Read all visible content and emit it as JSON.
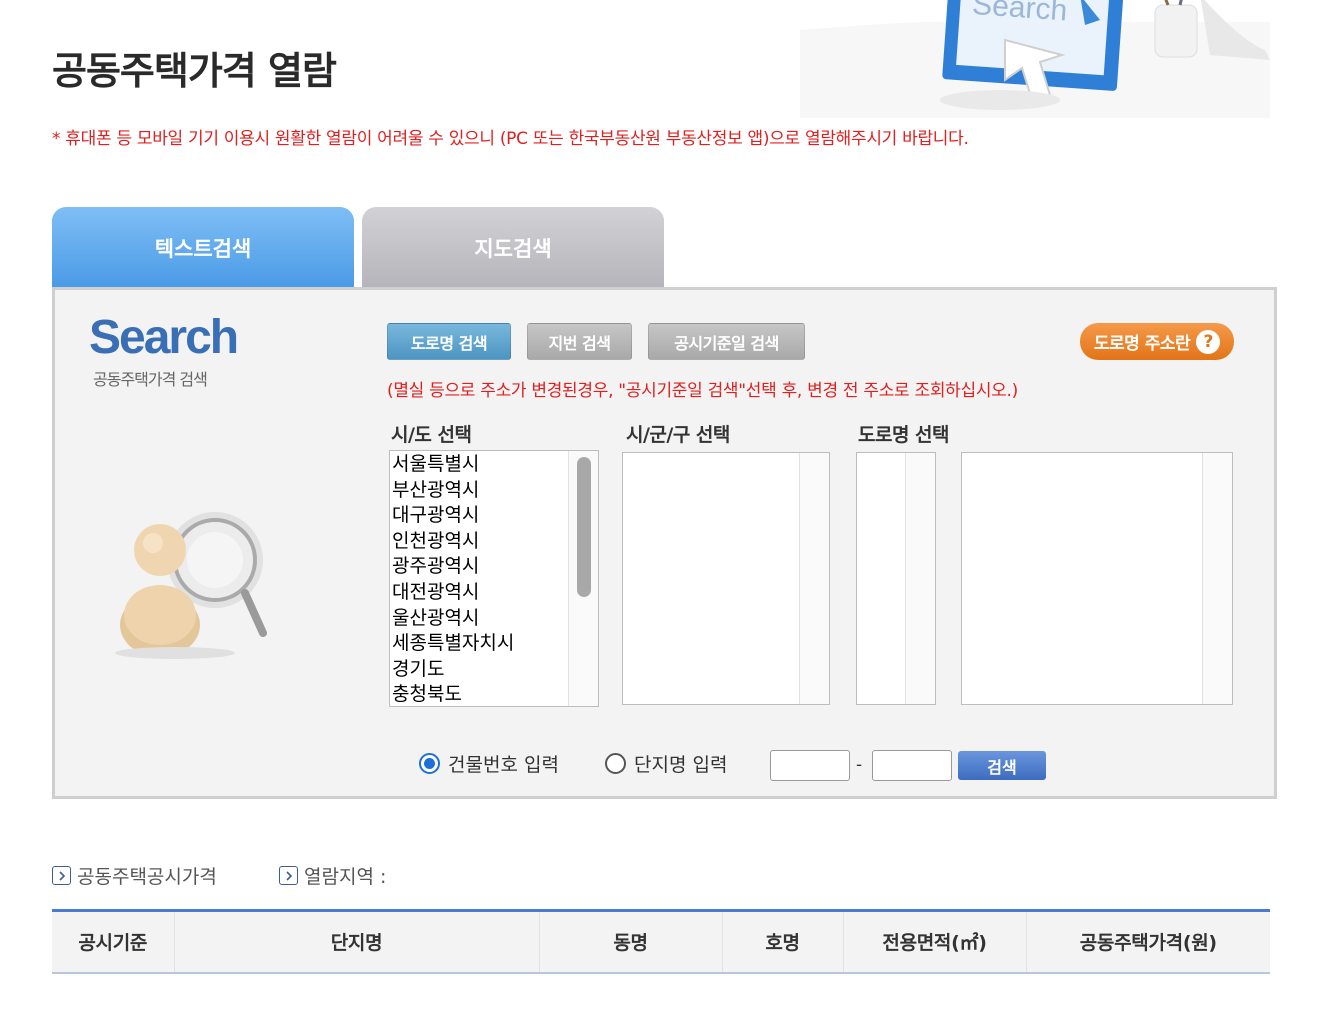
{
  "page": {
    "title": "공동주택가격 열람",
    "notice": "* 휴대폰 등 모바일 기기 이용시 원활한 열람이 어려울 수 있으니 (PC 또는 한국부동산원 부동산정보 앱)으로 열람해주시기 바랍니다.",
    "hero_text": "Search"
  },
  "tabs": [
    {
      "label": "텍스트검색",
      "active": true
    },
    {
      "label": "지도검색",
      "active": false
    }
  ],
  "search_panel": {
    "logo": "Search",
    "logo_sub": "공동주택가격 검색",
    "buttons": {
      "road": "도로명 검색",
      "jibun": "지번 검색",
      "date": "공시기준일 검색",
      "guide": "도로명 주소란",
      "guide_icon": "?"
    },
    "notice": "(멸실 등으로 주소가 변경된경우, \"공시기준일 검색\"선택 후, 변경 전 주소로 조회하십시오.)",
    "labels": {
      "sido": "시/도 선택",
      "sigungu": "시/군/구 선택",
      "road": "도로명 선택"
    },
    "sido_options": [
      "서울특별시",
      "부산광역시",
      "대구광역시",
      "인천광역시",
      "광주광역시",
      "대전광역시",
      "울산광역시",
      "세종특별자치시",
      "경기도",
      "충청북도"
    ],
    "radios": {
      "building": "건물번호 입력",
      "complex": "단지명 입력"
    },
    "dash": "-",
    "search_button": "검색"
  },
  "results": {
    "meta_price": "공동주택공시가격",
    "meta_region": "열람지역 :",
    "columns": [
      "공시기준",
      "단지명",
      "동명",
      "호명",
      "전용면적(㎡)",
      "공동주택가격(원)"
    ]
  },
  "colors": {
    "accent_blue": "#4a9ae6",
    "notice_red": "#e0201f",
    "guide_orange": "#e27418"
  }
}
